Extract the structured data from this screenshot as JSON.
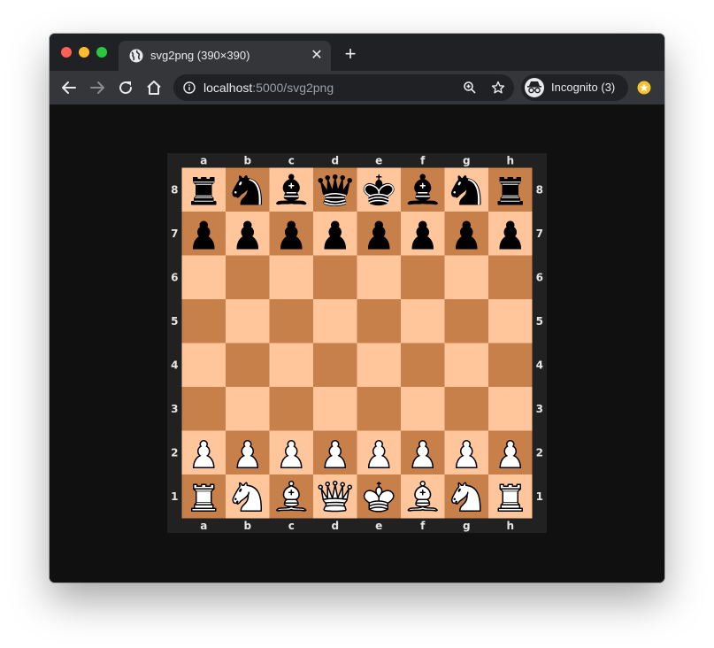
{
  "tab": {
    "title": "svg2png (390×390)",
    "favicon": "globe-icon",
    "close_glyph": "✕",
    "new_tab_glyph": "+"
  },
  "toolbar": {
    "url_host": "localhost",
    "url_path": ":5000/svg2png",
    "incognito_label": "Incognito (3)"
  },
  "board": {
    "files": [
      "a",
      "b",
      "c",
      "d",
      "e",
      "f",
      "g",
      "h"
    ],
    "ranks": [
      "8",
      "7",
      "6",
      "5",
      "4",
      "3",
      "2",
      "1"
    ],
    "position": [
      [
        "r",
        "n",
        "b",
        "q",
        "k",
        "b",
        "n",
        "r"
      ],
      [
        "p",
        "p",
        "p",
        "p",
        "p",
        "p",
        "p",
        "p"
      ],
      [
        "",
        "",
        "",
        "",
        "",
        "",
        "",
        ""
      ],
      [
        "",
        "",
        "",
        "",
        "",
        "",
        "",
        ""
      ],
      [
        "",
        "",
        "",
        "",
        "",
        "",
        "",
        ""
      ],
      [
        "",
        "",
        "",
        "",
        "",
        "",
        "",
        ""
      ],
      [
        "P",
        "P",
        "P",
        "P",
        "P",
        "P",
        "P",
        "P"
      ],
      [
        "R",
        "N",
        "B",
        "Q",
        "K",
        "B",
        "N",
        "R"
      ]
    ],
    "colors": {
      "light": "#fec69a",
      "dark": "#c8804b",
      "border": "#212121",
      "coord": "#e5e5e5"
    }
  }
}
